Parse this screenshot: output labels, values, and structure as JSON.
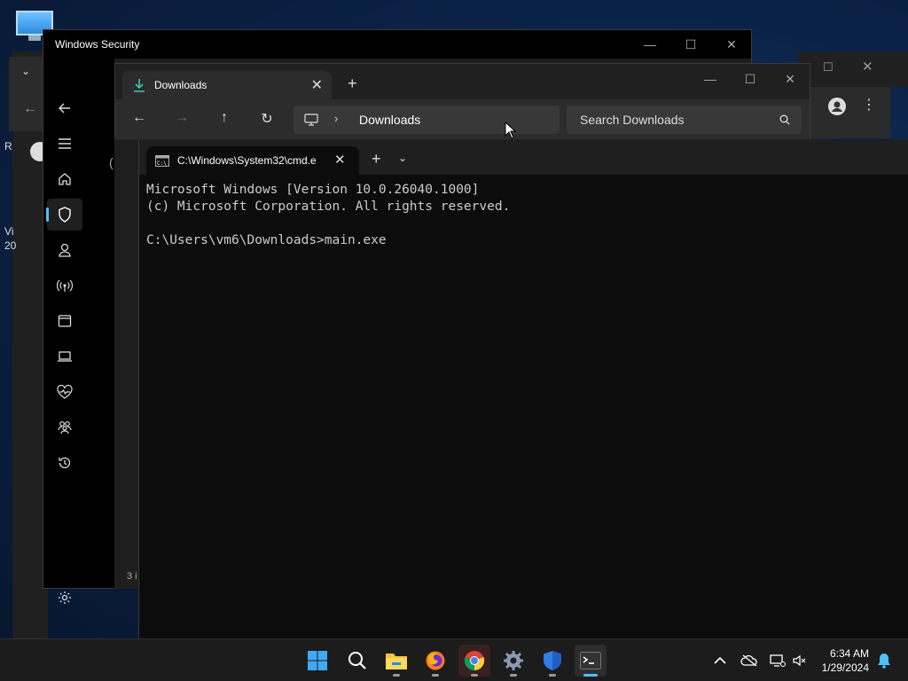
{
  "windows_security": {
    "title": "Windows Security",
    "nav_icons": [
      "back-arrow-icon",
      "hamburger-icon",
      "home-icon",
      "shield-icon",
      "account-icon",
      "wireless-icon",
      "browser-window-icon",
      "laptop-icon",
      "heart-pulse-icon",
      "family-icon",
      "history-icon",
      "gear-icon"
    ],
    "selected": "shield-icon"
  },
  "desktop": {
    "fragments": [
      "R",
      "Vi",
      "20"
    ]
  },
  "file_explorer": {
    "tab_label": "Downloads",
    "address_path": "Downloads",
    "search_placeholder": "Search Downloads",
    "status": "3 i"
  },
  "terminal": {
    "tab_label": "C:\\Windows\\System32\\cmd.e",
    "lines": [
      "Microsoft Windows [Version 10.0.26040.1000]",
      "(c) Microsoft Corporation. All rights reserved.",
      "",
      "C:\\Users\\vm6\\Downloads>main.exe"
    ]
  },
  "taskbar": {
    "apps": [
      "start-icon",
      "search-icon",
      "file-explorer-icon",
      "firefox-icon",
      "chrome-icon",
      "settings-icon",
      "windows-security-icon",
      "terminal-icon"
    ],
    "active_app": "terminal-icon",
    "time": "6:34 AM",
    "date": "1/29/2024"
  },
  "colors": {
    "accent": "#4cc2ff",
    "terminal_bg": "#0c0c0c",
    "taskbar_bg": "#1c1c1c"
  }
}
